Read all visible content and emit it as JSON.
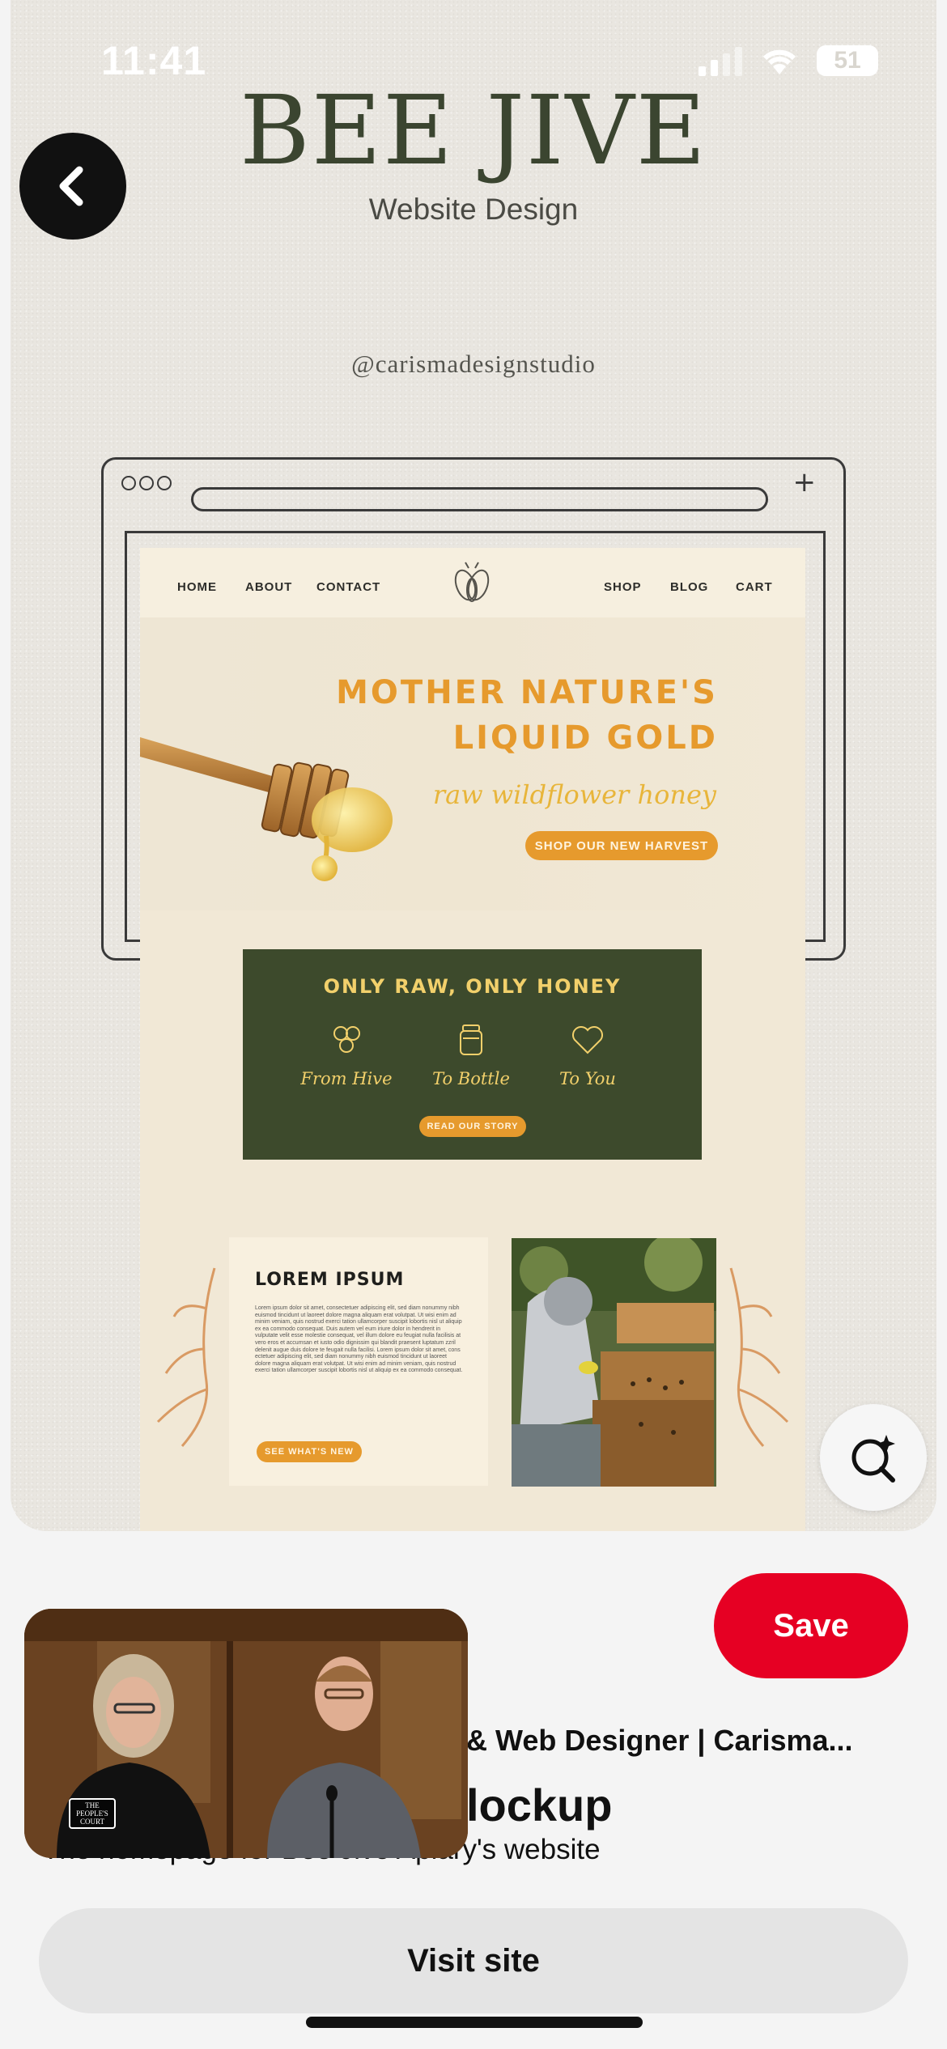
{
  "status": {
    "time": "11:41",
    "battery": "51"
  },
  "pin": {
    "brand_title": "BEE JIVE",
    "brand_subtitle": "Website Design",
    "handle": "@carismadesignstudio",
    "site": {
      "nav_left": [
        "HOME",
        "ABOUT",
        "CONTACT"
      ],
      "nav_right": [
        "SHOP",
        "BLOG",
        "CART"
      ],
      "hero_line1": "MOTHER NATURE'S",
      "hero_line2": "LIQUID GOLD",
      "hero_script": "raw wildflower honey",
      "hero_cta": "SHOP OUR NEW HARVEST",
      "feature_title": "ONLY RAW, ONLY HONEY",
      "features": [
        "From Hive",
        "To Bottle",
        "To You"
      ],
      "feature_cta": "READ OUR STORY",
      "card_title": "LOREM IPSUM",
      "card_text": "Lorem ipsum dolor sit amet, consectetuer adipiscing elit, sed diam nonummy nibh euismod tincidunt ut laoreet dolore magna aliquam erat volutpat. Ut wisi enim ad minim veniam, quis nostrud exerci tation ullamcorper suscipit lobortis nisl ut aliquip ex ea commodo consequat. Duis autem vel eum iriure dolor in hendrerit in vulputate velit esse molestie consequat, vel illum dolore eu feugiat nulla facilisis at vero eros et accumsan et iusto odio dignissim qui blandit praesent luptatum zzril delenit augue duis dolore te feugait nulla facilisi. Lorem ipsum dolor sit amet, cons ectetuer adipiscing elit, sed diam nonummy nibh euismod tincidunt ut laoreet dolore magna aliquam erat volutpat. Ut wisi enim ad minim veniam, quis nostrud exerci tation ullamcorper suscipit lobortis nisl ut aliquip ex ea commodo consequat.",
      "card_cta": "SEE WHAT'S NEW"
    }
  },
  "sheet": {
    "save_label": "Save",
    "creator_line": "& Web Designer | Carisma...",
    "title": "lockup",
    "description": "The homepage for Bee Jive Apiary's website",
    "visit_label": "Visit site"
  },
  "video": {
    "badge": "THE PEOPLE'S COURT"
  },
  "colors": {
    "accent": "#e60023",
    "honey": "#e69a2d",
    "olive": "#3d4a2c"
  },
  "icons": [
    "back-arrow-icon",
    "visual-search-icon",
    "bee-logo-icon",
    "honeycomb-icon",
    "jar-icon",
    "heart-icon"
  ]
}
